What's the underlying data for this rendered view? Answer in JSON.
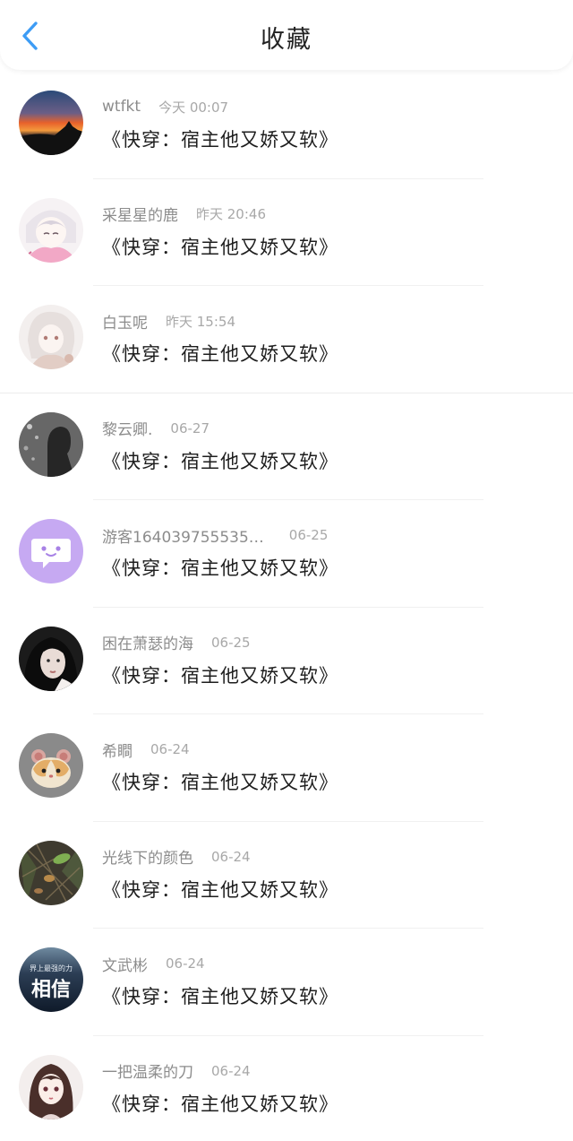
{
  "header": {
    "title": "收藏",
    "back_icon": "chevron-left-icon",
    "accent_color": "#3d9cf5"
  },
  "items": [
    {
      "username": "wtfkt",
      "time": "今天 00:07",
      "content": "《快穿：宿主他又娇又软》",
      "avatar": "sunset-silhouette-avatar"
    },
    {
      "username": "采星星的鹿",
      "time": "昨天 20:46",
      "content": "《快穿：宿主他又娇又软》",
      "avatar": "anime-girl-pink-avatar"
    },
    {
      "username": "白玉呢",
      "time": "昨天 15:54",
      "content": "《快穿：宿主他又娇又软》",
      "avatar": "anime-girl-white-avatar"
    },
    {
      "username": "黎云卿.",
      "time": "06-27",
      "content": "《快穿：宿主他又娇又软》",
      "avatar": "night-silhouette-avatar"
    },
    {
      "username": "游客164039755535…",
      "time": "06-25",
      "content": "《快穿：宿主他又娇又软》",
      "avatar": "purple-chat-bubble-avatar"
    },
    {
      "username": "困在萧瑟的海",
      "time": "06-25",
      "content": "《快穿：宿主他又娇又软》",
      "avatar": "dark-portrait-avatar"
    },
    {
      "username": "希瞷",
      "time": "06-24",
      "content": "《快穿：宿主他又娇又软》",
      "avatar": "hamster-emoji-avatar"
    },
    {
      "username": "光线下的颜色",
      "time": "06-24",
      "content": "《快穿：宿主他又娇又软》",
      "avatar": "forest-floor-avatar"
    },
    {
      "username": "文武彬",
      "time": "06-24",
      "content": "《快穿：宿主他又娇又软》",
      "avatar": "xiangxin-text-avatar",
      "avatar_text": "相信",
      "avatar_subtext": "界上最强的力"
    },
    {
      "username": "一把温柔的刀",
      "time": "06-24",
      "content": "《快穿：宿主他又娇又软》",
      "avatar": "anime-girl-brown-hair-avatar"
    }
  ]
}
